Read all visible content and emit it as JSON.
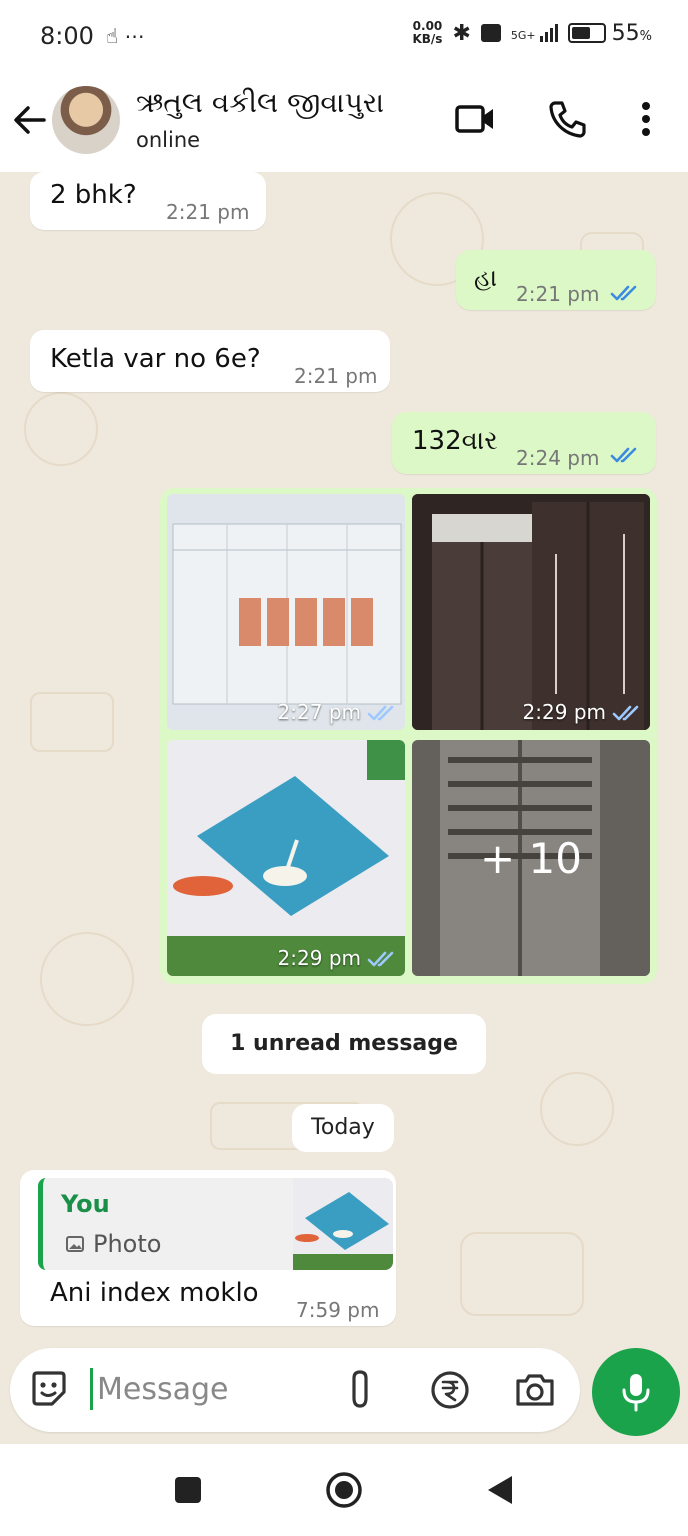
{
  "status_bar": {
    "time": "8:00",
    "left_icons": "⋯",
    "netspeed_value": "0.00",
    "netspeed_unit": "KB/s",
    "network": "5G+",
    "battery": "55"
  },
  "header": {
    "contact_name": "ઋતુલ વકીલ જીવાપુરા",
    "status": "online"
  },
  "messages": [
    {
      "text": "2 bhk?",
      "time": "2:21 pm"
    },
    {
      "text": "હા",
      "time": "2:21 pm"
    },
    {
      "text": "Ketla var no 6e?",
      "time": "2:21 pm"
    },
    {
      "text": "132વાર",
      "time": "2:24 pm"
    }
  ],
  "gallery": {
    "items": [
      {
        "time": "2:27 pm"
      },
      {
        "time": "2:29 pm"
      },
      {
        "time": "2:29 pm"
      },
      {
        "overlay": "+ 10"
      }
    ]
  },
  "unread_label": "1 unread message",
  "date_label": "Today",
  "reply": {
    "quote_author": "You",
    "quote_type": "Photo",
    "text": "Ani index moklo",
    "time": "7:59 pm"
  },
  "composer": {
    "placeholder": "Message"
  },
  "colors": {
    "accent": "#1aa34a",
    "outgoing": "#dcf8c6",
    "background": "#efe9dd",
    "read_ticks": "#3b8be0"
  }
}
